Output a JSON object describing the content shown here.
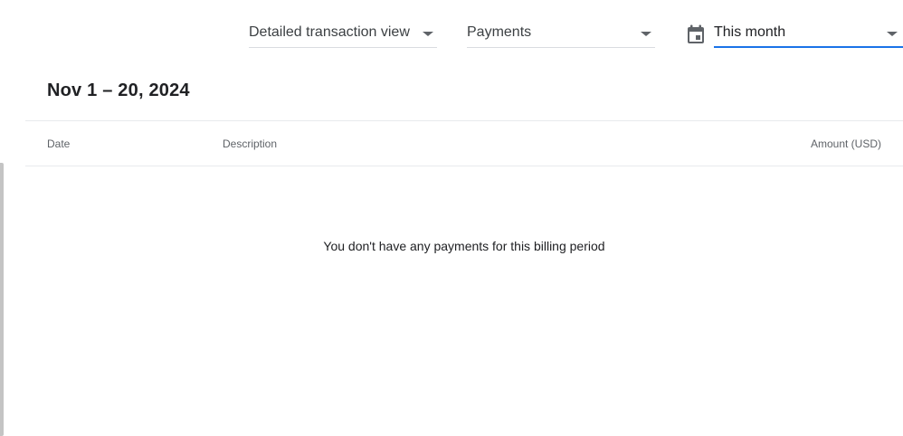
{
  "filters": {
    "view": {
      "value": "Detailed transaction view"
    },
    "type": {
      "value": "Payments"
    },
    "date_range": {
      "value": "This month"
    }
  },
  "period": {
    "title": "Nov 1 – 20, 2024"
  },
  "table": {
    "columns": {
      "date": "Date",
      "description": "Description",
      "amount": "Amount (USD)"
    },
    "rows": [],
    "empty_message": "You don't have any payments for this billing period"
  },
  "icons": {
    "calendar": "calendar-icon",
    "dropdown": "chevron-down-icon"
  },
  "colors": {
    "accent": "#1a73e8",
    "text_primary": "#202124",
    "text_secondary": "#5f6368",
    "divider": "#e8eaed"
  }
}
